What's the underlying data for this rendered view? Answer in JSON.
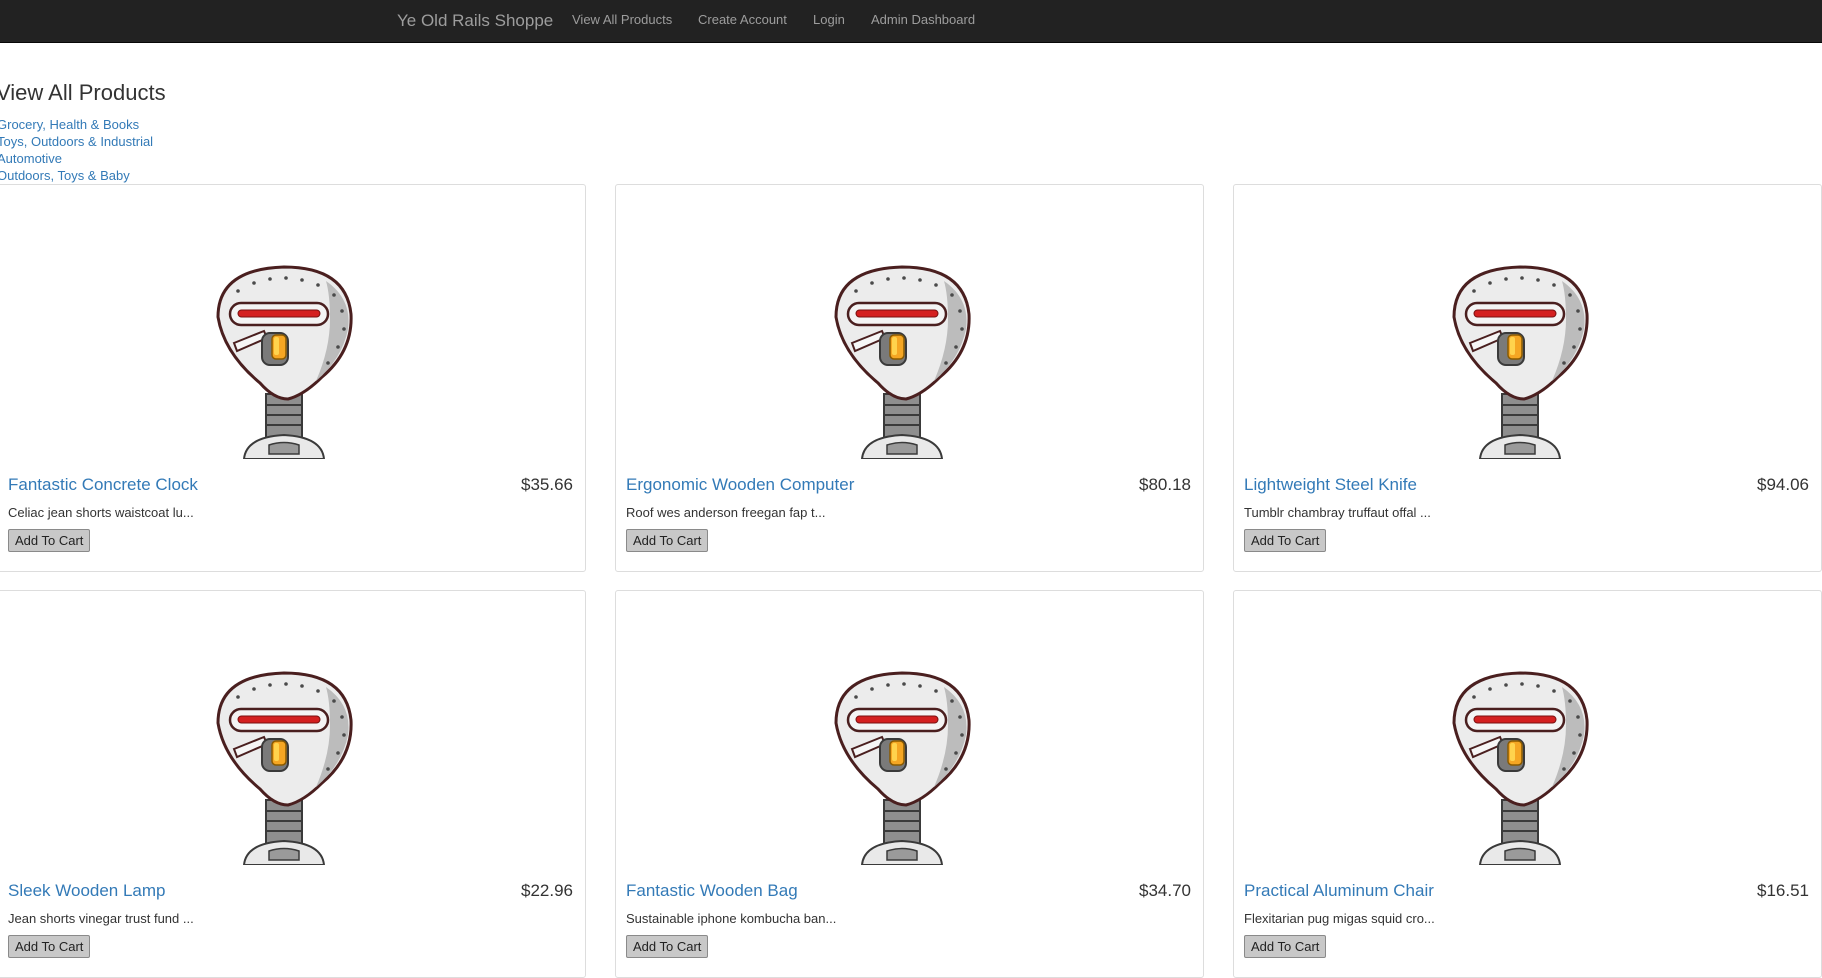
{
  "nav": {
    "brand": "Ye Old Rails Shoppe",
    "links": [
      "View All Products",
      "Create Account",
      "Login",
      "Admin Dashboard"
    ]
  },
  "page": {
    "title": "View All Products"
  },
  "categories": [
    "Grocery, Health & Books",
    "Toys, Outdoors & Industrial",
    "Automotive",
    "Outdoors, Toys & Baby"
  ],
  "products": [
    {
      "name": "Fantastic Concrete Clock",
      "price": "$35.66",
      "description": "Celiac jean shorts waistcoat lu...",
      "button": "Add To Cart"
    },
    {
      "name": "Ergonomic Wooden Computer",
      "price": "$80.18",
      "description": "Roof wes anderson freegan fap t...",
      "button": "Add To Cart"
    },
    {
      "name": "Lightweight Steel Knife",
      "price": "$94.06",
      "description": "Tumblr chambray truffaut offal ...",
      "button": "Add To Cart"
    },
    {
      "name": "Sleek Wooden Lamp",
      "price": "$22.96",
      "description": "Jean shorts vinegar trust fund ...",
      "button": "Add To Cart"
    },
    {
      "name": "Fantastic Wooden Bag",
      "price": "$34.70",
      "description": "Sustainable iphone kombucha ban...",
      "button": "Add To Cart"
    },
    {
      "name": "Practical Aluminum Chair",
      "price": "$16.51",
      "description": "Flexitarian pug migas squid cro...",
      "button": "Add To Cart"
    }
  ],
  "colors": {
    "navbar_bg": "#222222",
    "nav_text": "#9d9d9d",
    "link": "#337ab7",
    "card_border": "#dddddd",
    "button_bg": "#c8c8c8"
  },
  "icons": {
    "product_image": "robot-head-icon"
  }
}
